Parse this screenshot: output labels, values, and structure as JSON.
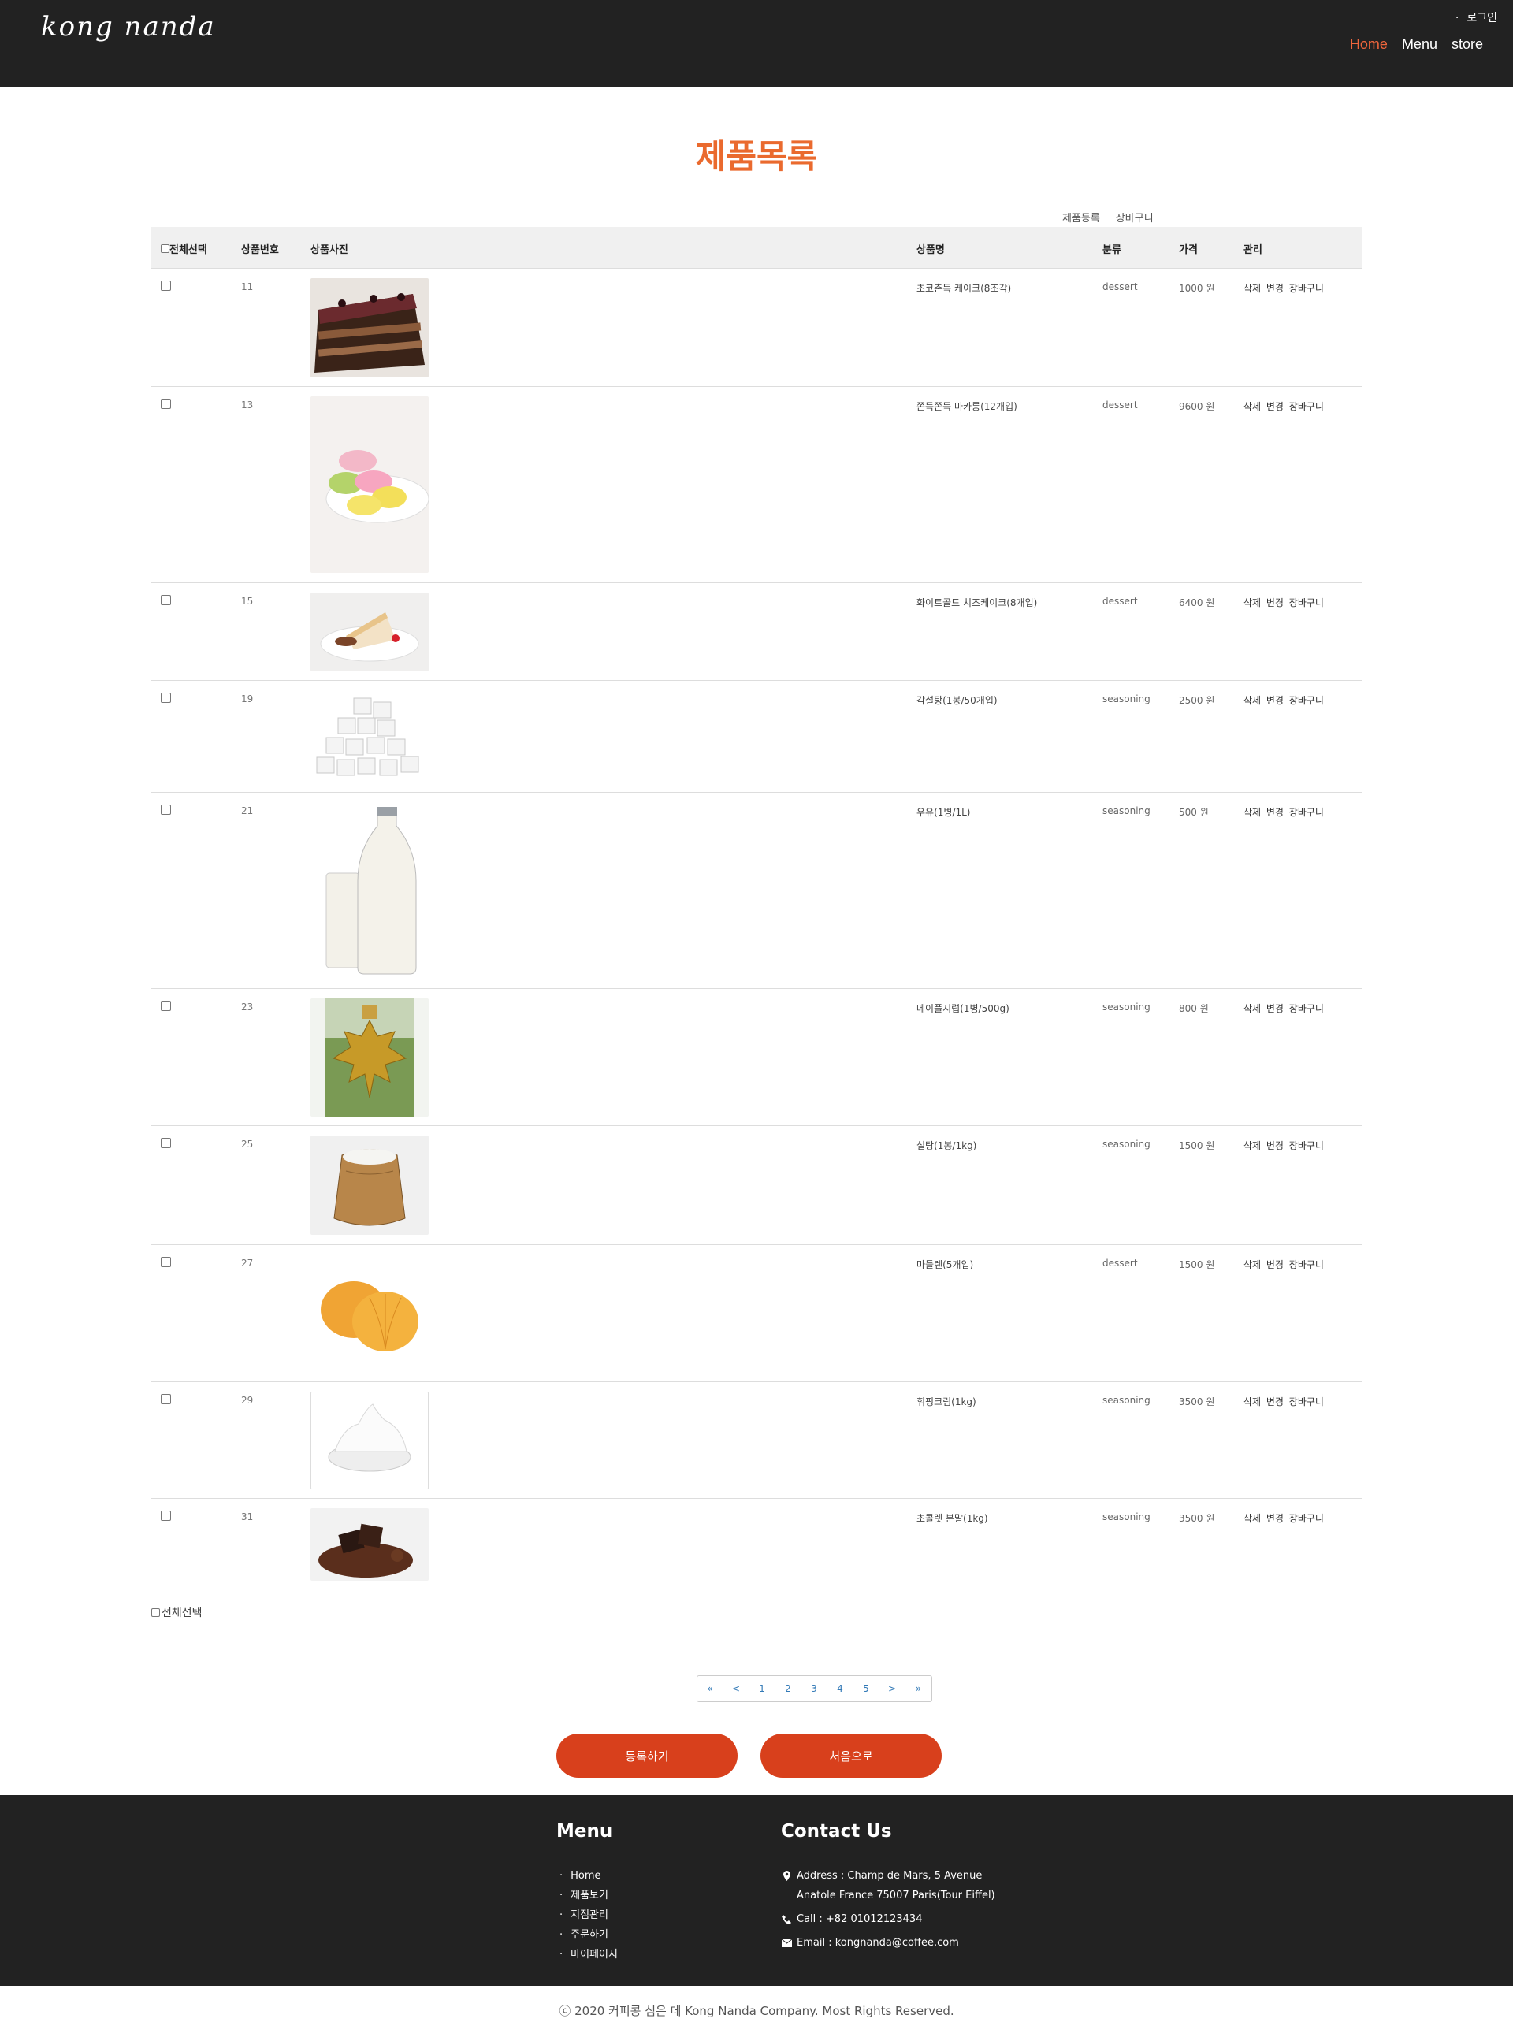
{
  "header": {
    "logo": "kong nanda",
    "login": "로그인",
    "nav": [
      {
        "label": "Home",
        "active": true
      },
      {
        "label": "Menu",
        "active": false
      },
      {
        "label": "store",
        "active": false
      }
    ]
  },
  "page_title": "제품목록",
  "top_links": {
    "register": "제품등록",
    "cart": "장바구니"
  },
  "table": {
    "headers": {
      "select_all": "전체선택",
      "no": "상품번호",
      "photo": "상품사진",
      "name": "상품명",
      "category": "분류",
      "price": "가격",
      "manage": "관리"
    },
    "rows": [
      {
        "no": "11",
        "name": "초코촌득 케이크(8조각)",
        "category": "dessert",
        "price": "1000 원",
        "manage": "삭제 변경 장바구니",
        "image": "chocolate-cake"
      },
      {
        "no": "13",
        "name": "쫀득쫀득 마카롱(12개입)",
        "category": "dessert",
        "price": "9600 원",
        "manage": "삭제 변경 장바구니",
        "image": "macaron"
      },
      {
        "no": "15",
        "name": "화이트골드 치즈케이크(8개입)",
        "category": "dessert",
        "price": "6400 원",
        "manage": "삭제 변경 장바구니",
        "image": "cheesecake"
      },
      {
        "no": "19",
        "name": "각설탕(1봉/50개입)",
        "category": "seasoning",
        "price": "2500 원",
        "manage": "삭제 변경 장바구니",
        "image": "sugar-cubes"
      },
      {
        "no": "21",
        "name": "우유(1병/1L)",
        "category": "seasoning",
        "price": "500 원",
        "manage": "삭제 변경 장바구니",
        "image": "milk"
      },
      {
        "no": "23",
        "name": "메이플시럽(1병/500g)",
        "category": "seasoning",
        "price": "800 원",
        "manage": "삭제 변경 장바구니",
        "image": "maple-syrup"
      },
      {
        "no": "25",
        "name": "설탕(1봉/1kg)",
        "category": "seasoning",
        "price": "1500 원",
        "manage": "삭제 변경 장바구니",
        "image": "sugar-sack"
      },
      {
        "no": "27",
        "name": "마들렌(5개입)",
        "category": "dessert",
        "price": "1500 원",
        "manage": "삭제 변경 장바구니",
        "image": "madeleine"
      },
      {
        "no": "29",
        "name": "휘핑크림(1kg)",
        "category": "seasoning",
        "price": "3500 원",
        "manage": "삭제 변경 장바구니",
        "image": "whipped-cream"
      },
      {
        "no": "31",
        "name": "초콜렛 분말(1kg)",
        "category": "seasoning",
        "price": "3500 원",
        "manage": "삭제 변경 장바구니",
        "image": "chocolate-powder"
      }
    ]
  },
  "bottom_select_all": "전체선택",
  "pagination": [
    "«",
    "<",
    "1",
    "2",
    "3",
    "4",
    "5",
    ">",
    "»"
  ],
  "buttons": {
    "register": "등록하기",
    "home": "처음으로"
  },
  "footer": {
    "menu_title": "Menu",
    "menu": [
      "Home",
      "제품보기",
      "지점관리",
      "주문하기",
      "마이페이지"
    ],
    "contact_title": "Contact Us",
    "address": "Address : Champ de Mars, 5 Avenue Anatole France 75007 Paris(Tour Eiffel)",
    "call": "Call : +82 01012123434",
    "email": "Email : kongnanda@coffee.com"
  },
  "copyright": "ⓒ 2020 커피콩 심은 데 Kong Nanda Company. Most Rights Reserved."
}
